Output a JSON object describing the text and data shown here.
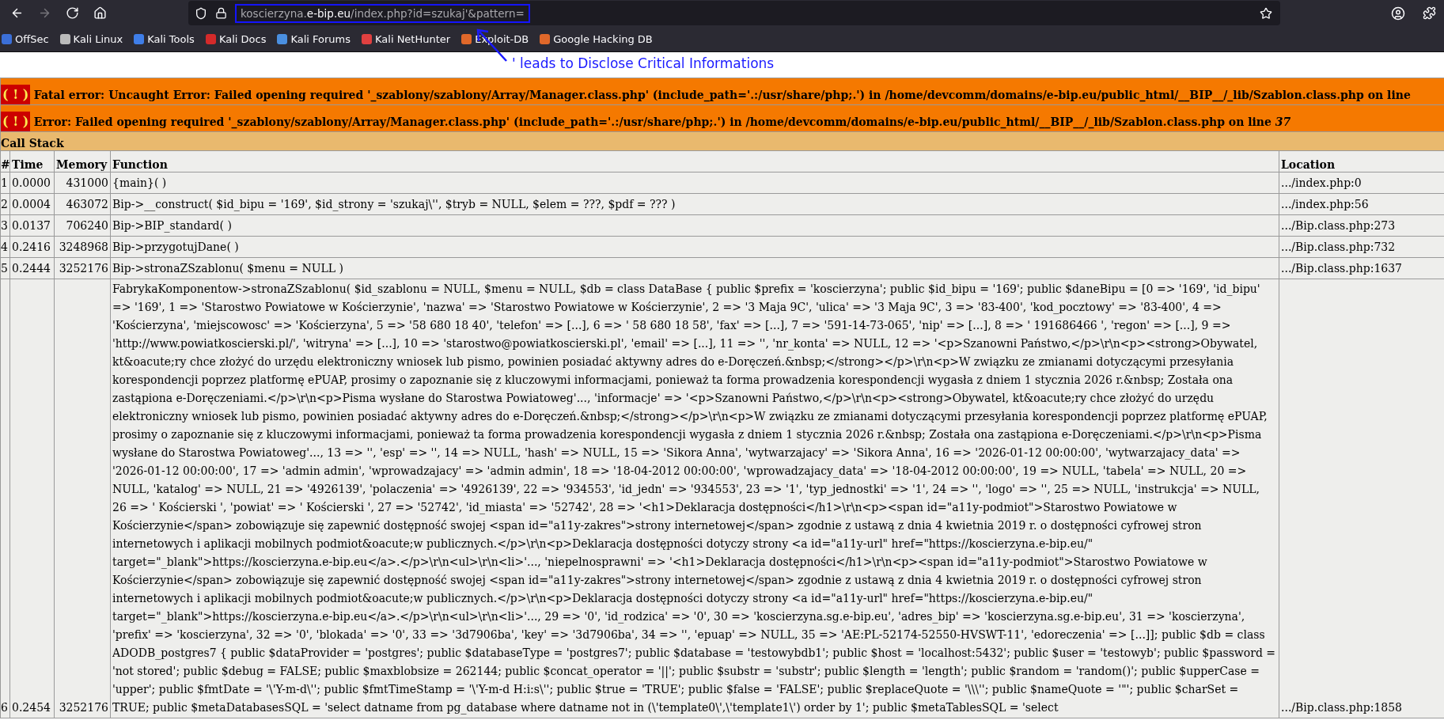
{
  "browser": {
    "nav_buttons": [
      {
        "kind": "back",
        "disabled": false
      },
      {
        "kind": "forward",
        "disabled": true
      },
      {
        "kind": "reload",
        "disabled": false
      },
      {
        "kind": "home",
        "disabled": false
      }
    ],
    "url": {
      "subdomain": "koscierzyna.",
      "domain": "e-bip.eu",
      "path": "/index.php?id=szukaj'&pattern="
    },
    "bookmarks": [
      {
        "label": "OffSec",
        "color": "#3b6fd8"
      },
      {
        "label": "Kali Linux",
        "color": "#bbbbbb"
      },
      {
        "label": "Kali Tools",
        "color": "#3f7ee8"
      },
      {
        "label": "Kali Docs",
        "color": "#d42a2a"
      },
      {
        "label": "Kali Forums",
        "color": "#4a8fe0"
      },
      {
        "label": "Kali NetHunter",
        "color": "#e04040"
      },
      {
        "label": "Exploit-DB",
        "color": "#e0682a"
      },
      {
        "label": "Google Hacking DB",
        "color": "#e0682a"
      }
    ]
  },
  "annotation": {
    "text": "' leads to Disclose Critical Informations"
  },
  "errors": [
    {
      "icon": "( ! )",
      "message": "Fatal error: Uncaught Error: Failed opening required '_szablony/szablony/Array/Manager.class.php' (include_path='.:/usr/share/php;.') in /home/devcomm/domains/e-bip.eu/public_html/__BIP__/_lib/Szablon.class.php on line"
    },
    {
      "icon": "( ! )",
      "message": "Error: Failed opening required '_szablony/szablony/Array/Manager.class.php' (include_path='.:/usr/share/php;.') in /home/devcomm/domains/e-bip.eu/public_html/__BIP__/_lib/Szablon.class.php on line *37*"
    }
  ],
  "call_stack": {
    "title": "Call Stack",
    "columns": [
      "#",
      "Time",
      "Memory",
      "Function",
      "Location"
    ],
    "rows": [
      [
        "1",
        "0.0000",
        "431000",
        "{main}( )",
        ".../index.php:0"
      ],
      [
        "2",
        "0.0004",
        "463072",
        "Bip->__construct( $id_bipu = '169', $id_strony = 'szukaj\\'', $tryb = NULL, $elem = ???, $pdf = ??? )",
        ".../index.php:56"
      ],
      [
        "3",
        "0.0137",
        "706240",
        "Bip->BIP_standard( )",
        ".../Bip.class.php:273"
      ],
      [
        "4",
        "0.2416",
        "3248968",
        "Bip->przygotujDane( )",
        ".../Bip.class.php:732"
      ],
      [
        "5",
        "0.2444",
        "3252176",
        "Bip->stronaZSzablonu( $menu = NULL )",
        ".../Bip.class.php:1637"
      ],
      [
        "6",
        "0.2454",
        "3252176",
        "FabrykaKomponentow->stronaZSzablonu( $id_szablonu = NULL, $menu = NULL, $db = class DataBase { public $prefix = 'koscierzyna'; public $id_bipu = '169'; public $daneBipu = [0 => '169', 'id_bipu' => '169', 1 => 'Starostwo Powiatowe w Kościerzynie', 'nazwa' => 'Starostwo Powiatowe w Kościerzynie', 2 => '3 Maja 9C', 'ulica' => '3 Maja 9C', 3 => '83-400', 'kod_pocztowy' => '83-400', 4 => 'Kościerzyna', 'miejscowosc' => 'Kościerzyna', 5 => '58 680 18 40', 'telefon' => [...], 6 => ' 58 680 18 58', 'fax' => [...], 7 => '591-14-73-065', 'nip' => [...], 8 => ' 191686466 ', 'regon' => [...], 9 => 'http://www.powiatkoscierski.pl/', 'witryna' => [...], 10 => 'starostwo@powiatkoscierski.pl', 'email' => [...], 11 => '', 'nr_konta' => NULL, 12 => '<p>Szanowni Państwo,</p>\\r\\n<p><strong>Obywatel, kt&oacute;ry chce złożyć do urzędu elektroniczny wniosek lub pismo, powinien posiadać aktywny adres do e-Doręczeń.&nbsp;</strong></p>\\r\\n<p>W związku ze zmianami dotyczącymi przesyłania korespondencji poprzez platformę ePUAP, prosimy o zapoznanie się z kluczowymi informacjami, ponieważ ta forma prowadzenia korespondencji wygasła z dniem 1 stycznia 2026 r.&nbsp; Została ona zastąpiona e-Doręczeniami.</p>\\r\\n<p>Pisma wysłane do Starostwa Powiatoweg'..., 'informacje' => '<p>Szanowni Państwo,</p>\\r\\n<p><strong>Obywatel, kt&oacute;ry chce złożyć do urzędu elektroniczny wniosek lub pismo, powinien posiadać aktywny adres do e-Doręczeń.&nbsp;</strong></p>\\r\\n<p>W związku ze zmianami dotyczącymi przesyłania korespondencji poprzez platformę ePUAP, prosimy o zapoznanie się z kluczowymi informacjami, ponieważ ta forma prowadzenia korespondencji wygasła z dniem 1 stycznia 2026 r.&nbsp; Została ona zastąpiona e-Doręczeniami.</p>\\r\\n<p>Pisma wysłane do Starostwa Powiatoweg'..., 13 => '', 'esp' => '', 14 => NULL, 'hash' => NULL, 15 => 'Sikora Anna', 'wytwarzajacy' => 'Sikora Anna', 16 => '2026-01-12 00:00:00', 'wytwarzajacy_data' => '2026-01-12 00:00:00', 17 => 'admin admin', 'wprowadzajacy' => 'admin admin', 18 => '18-04-2012 00:00:00', 'wprowadzajacy_data' => '18-04-2012 00:00:00', 19 => NULL, 'tabela' => NULL, 20 => NULL, 'katalog' => NULL, 21 => '4926139', 'polaczenia' => '4926139', 22 => '934553', 'id_jedn' => '934553', 23 => '1', 'typ_jednostki' => '1', 24 => '', 'logo' => '', 25 => NULL, 'instrukcja' => NULL, 26 => ' Kościerski ', 'powiat' => ' Kościerski ', 27 => '52742', 'id_miasta' => '52742', 28 => '<h1>Deklaracja dostępności</h1>\\r\\n<p><span id=\"a11y-podmiot\">Starostwo Powiatowe w Kościerzynie</span> zobowiązuje się zapewnić dostępność swojej <span id=\"a11y-zakres\">strony internetowej</span> zgodnie z ustawą z dnia 4 kwietnia 2019 r. o dostępności cyfrowej stron internetowych i aplikacji mobilnych podmiot&oacute;w publicznych.</p>\\r\\n<p>Deklaracja dostępności dotyczy strony <a id=\"a11y-url\" href=\"https://koscierzyna.e-bip.eu/\" target=\"_blank\">https://koscierzyna.e-bip.eu</a>.</p>\\r\\n<ul>\\r\\n<li>'..., 'niepelnosprawni' => '<h1>Deklaracja dostępności</h1>\\r\\n<p><span id=\"a11y-podmiot\">Starostwo Powiatowe w Kościerzynie</span> zobowiązuje się zapewnić dostępność swojej <span id=\"a11y-zakres\">strony internetowej</span> zgodnie z ustawą z dnia 4 kwietnia 2019 r. o dostępności cyfrowej stron internetowych i aplikacji mobilnych podmiot&oacute;w publicznych.</p>\\r\\n<p>Deklaracja dostępności dotyczy strony <a id=\"a11y-url\" href=\"https://koscierzyna.e-bip.eu/\" target=\"_blank\">https://koscierzyna.e-bip.eu</a>.</p>\\r\\n<ul>\\r\\n<li>'..., 29 => '0', 'id_rodzica' => '0', 30 => 'koscierzyna.sg.e-bip.eu', 'adres_bip' => 'koscierzyna.sg.e-bip.eu', 31 => 'koscierzyna', 'prefix' => 'koscierzyna', 32 => '0', 'blokada' => '0', 33 => '3d7906ba', 'key' => '3d7906ba', 34 => '', 'epuap' => NULL, 35 => 'AE:PL-52174-52550-HVSWT-11', 'edoreczenia' => [...]]; public $db = class ADODB_postgres7 { public $dataProvider = 'postgres'; public $databaseType = 'postgres7'; public $database = 'testowybdb1'; public $host = 'localhost:5432'; public $user = 'testowyb'; public $password = 'not stored'; public $debug = FALSE; public $maxblobsize = 262144; public $concat_operator = '||'; public $substr = 'substr'; public $length = 'length'; public $random = 'random()'; public $upperCase = 'upper'; public $fmtDate = '\\'Y-m-d\\''; public $fmtTimeStamp = '\\'Y-m-d H:i:s\\''; public $true = 'TRUE'; public $false = 'FALSE'; public $replaceQuote = '\\\\\\''; public $nameQuote = '\"'; public $charSet = TRUE; public $metaDatabasesSQL = 'select datname from pg_database where datname not in (\\'template0\\',\\'template1\\') order by 1'; public $metaTablesSQL = 'select",
        ".../Bip.class.php:1858"
      ]
    ]
  }
}
